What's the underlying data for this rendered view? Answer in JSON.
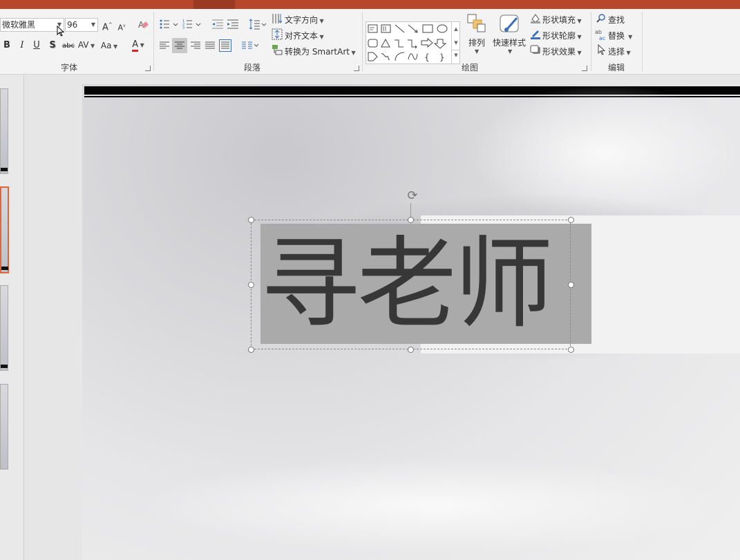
{
  "ribbon": {
    "font": {
      "group_label": "字体",
      "font_name": "微软雅黑",
      "font_size": "96",
      "grow_font": "A",
      "shrink_font": "A",
      "bold": "B",
      "italic": "I",
      "underline": "U",
      "shadow": "S",
      "strikethrough": "abc",
      "char_spacing": "AV",
      "change_case": "Aa",
      "font_color_glyph": "A",
      "font_color": "#e02020"
    },
    "paragraph": {
      "group_label": "段落",
      "text_direction": "文字方向",
      "align_text": "对齐文本",
      "convert_smartart": "转换为 SmartArt"
    },
    "drawing": {
      "group_label": "绘图",
      "arrange": "排列",
      "quick_styles": "快速样式",
      "shape_fill": "形状填充",
      "shape_outline": "形状轮廓",
      "shape_effects": "形状效果"
    },
    "editing": {
      "group_label": "编辑",
      "find": "查找",
      "replace": "替换",
      "select": "选择"
    }
  },
  "slide": {
    "text": "寻老师"
  },
  "colors": {
    "accent": "#b7472a",
    "selected_thumb_border": "#e0643c",
    "textbox_fill": "#aaaaaa",
    "text": "#373737"
  }
}
